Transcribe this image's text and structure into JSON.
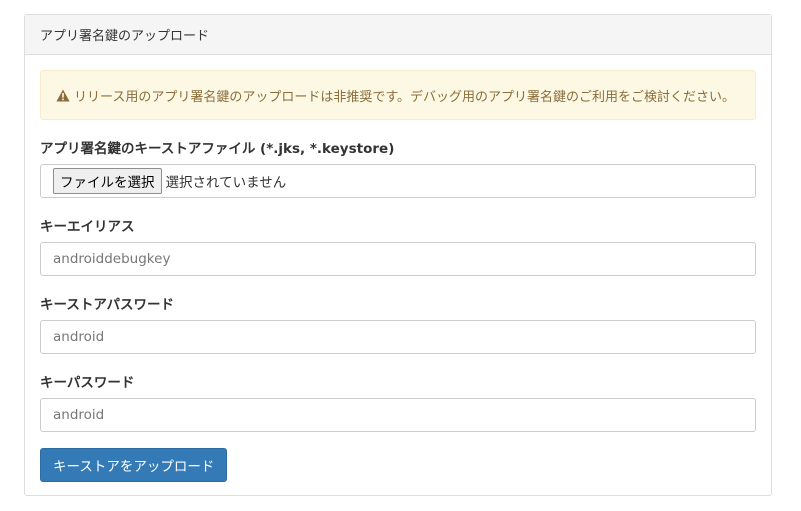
{
  "panel": {
    "title": "アプリ署名鍵のアップロード"
  },
  "alert": {
    "icon": "warning-triangle-icon",
    "text": "リリース用のアプリ署名鍵のアップロードは非推奨です。デバッグ用のアプリ署名鍵のご利用をご検討ください。",
    "color": "#8a6d3b",
    "background": "#fcf8e3"
  },
  "keystore_file": {
    "label": "アプリ署名鍵のキーストアファイル (*.jks, *.keystore)",
    "button_label": "ファイルを選択",
    "status_text": "選択されていません"
  },
  "key_alias": {
    "label": "キーエイリアス",
    "placeholder": "androiddebugkey"
  },
  "keystore_password": {
    "label": "キーストアパスワード",
    "placeholder": "android"
  },
  "key_password": {
    "label": "キーパスワード",
    "placeholder": "android"
  },
  "submit": {
    "label": "キーストアをアップロード",
    "color": "#337ab7"
  }
}
